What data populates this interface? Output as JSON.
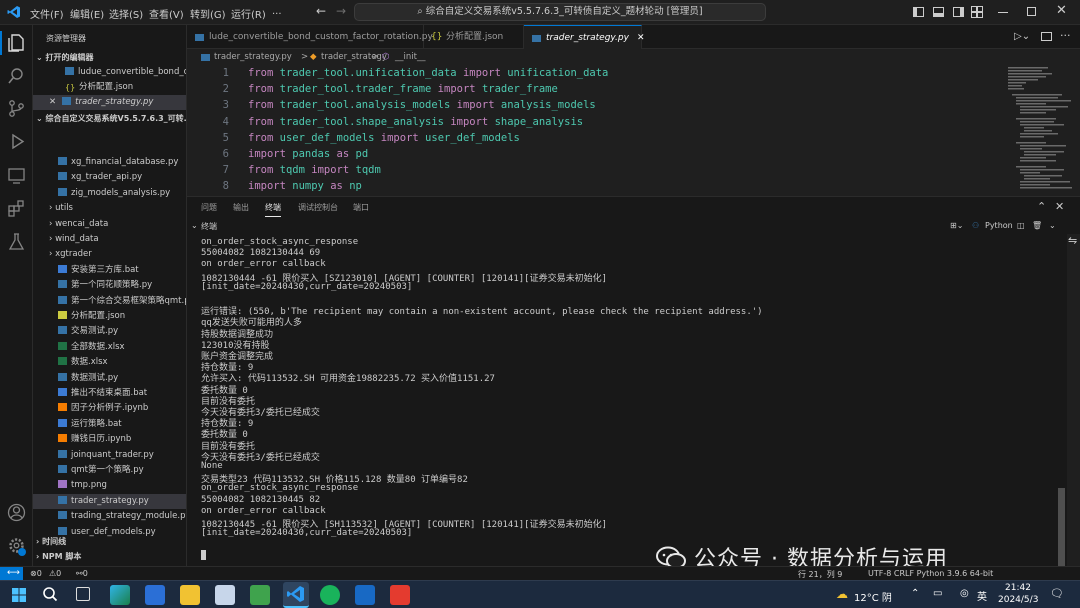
{
  "menu": [
    "文件(F)",
    "编辑(E)",
    "选择(S)",
    "查看(V)",
    "转到(G)",
    "运行(R)",
    "..."
  ],
  "command_center": "综合自定义交易系统v5.5.7.6.3_可转债自定义_题材轮动 [管理员]",
  "sidebar": {
    "title": "资源管理器",
    "open_editors_label": "打开的编辑器",
    "open_editors": [
      "ludue_convertible_bond_c...",
      "分析配置.json",
      "trader_strategy.py"
    ],
    "project_label": "综合自定义交易系统V5.5.7.6.3_可转...",
    "files": [
      "xg_financial_database.py",
      "xg_trader_api.py",
      "zig_models_analysis.py",
      "utils",
      "wencai_data",
      "wind_data",
      "xgtrader",
      "安装第三方库.bat",
      "第一个同花顺策略.py",
      "第一个综合交易框架策略qmt.py",
      "分析配置.json",
      "交易测试.py",
      "全部数据.xlsx",
      "数据.xlsx",
      "数据测试.py",
      "推出不结束桌面.bat",
      "因子分析例子.ipynb",
      "运行策略.bat",
      "赚钱日历.ipynb",
      "joinquant_trader.py",
      "qmt第一个策略.py",
      "tmp.png",
      "trader_strategy.py",
      "trading_strategy_module.py",
      "user_def_models.py"
    ],
    "timeline_label": "时间线",
    "npm_label": "NPM 脚本"
  },
  "tabs": [
    "lude_convertible_bond_custom_factor_rotation.py",
    "分析配置.json",
    "trader_strategy.py"
  ],
  "breadcrumb": {
    "file": "trader_strategy.py",
    "sep": ">",
    "cls": "trader_strategy",
    "method": "__init__"
  },
  "code_lines": [
    {
      "n": "1",
      "a": "from",
      "b": "trader_tool.unification_data",
      "c": "import",
      "d": "unification_data"
    },
    {
      "n": "2",
      "a": "from",
      "b": "trader_tool.trader_frame",
      "c": "import",
      "d": "trader_frame"
    },
    {
      "n": "3",
      "a": "from",
      "b": "trader_tool.analysis_models",
      "c": "import",
      "d": "analysis_models"
    },
    {
      "n": "4",
      "a": "from",
      "b": "trader_tool.shape_analysis",
      "c": "import",
      "d": "shape_analysis"
    },
    {
      "n": "5",
      "a": "from",
      "b": "user_def_models",
      "c": "import",
      "d": "user_def_models"
    },
    {
      "n": "6",
      "a": "import",
      "b": "pandas",
      "c": "as",
      "d": "pd"
    },
    {
      "n": "7",
      "a": "from",
      "b": "tqdm",
      "c": "import",
      "d": "tqdm"
    },
    {
      "n": "8",
      "a": "import",
      "b": "numpy",
      "c": "as",
      "d": "np"
    }
  ],
  "panel_tabs": [
    "问题",
    "输出",
    "终端",
    "调试控制台",
    "端口"
  ],
  "terminal_label": "终端",
  "terminal_profile": "Python",
  "terminal_lines": [
    "on_order_stock_async_response",
    "55004082 1082130444 69",
    "on order_error callback",
    "1082130444 -61 限价买入 [SZ123010] [AGENT] [COUNTER] [120141][证券交易未初始化]",
    "[init_date=20240430,curr_date=20240503]",
    "",
    "运行错误: (550, b'The recipient may contain a non-existent account, please check the recipient address.')",
    "qq发送失败可能用的人多",
    "持股数据调整成功",
    "123010没有持股",
    "账户资金调整完成",
    "持仓数量: 9",
    "允许买入: 代码113532.SH 可用资金19882235.72 买入价值1151.27",
    "委托数量 0",
    "目前没有委托",
    "今天没有委托3/委托已经成交",
    "持仓数量: 9",
    "委托数量 0",
    "目前没有委托",
    "今天没有委托3/委托已经成交",
    "None",
    "交易类型23 代码113532.SH 价格115.128 数量80 订单编号82",
    "on_order_stock_async_response",
    "55004082 1082130445 82",
    "on order_error callback",
    "1082130445 -61 限价买入 [SH113532] [AGENT] [COUNTER] [120141][证券交易未初始化]",
    "[init_date=20240430,curr_date=20240503]"
  ],
  "status": {
    "errors": "⊗0",
    "warnings": "⚠0",
    "ports": "⚯0",
    "position": "行 21，列 9",
    "right": "UTF-8  CRLF  Python  3.9.6 64-bit"
  },
  "watermark": "公众号 · 数据分析与运用",
  "taskbar": {
    "weather": "12°C 阴",
    "lang": "英",
    "time": "21:42",
    "date": "2024/5/3"
  },
  "colors": {
    "accent": "#0078d4",
    "keyword": "#c586c0",
    "module": "#4ec9b0"
  }
}
